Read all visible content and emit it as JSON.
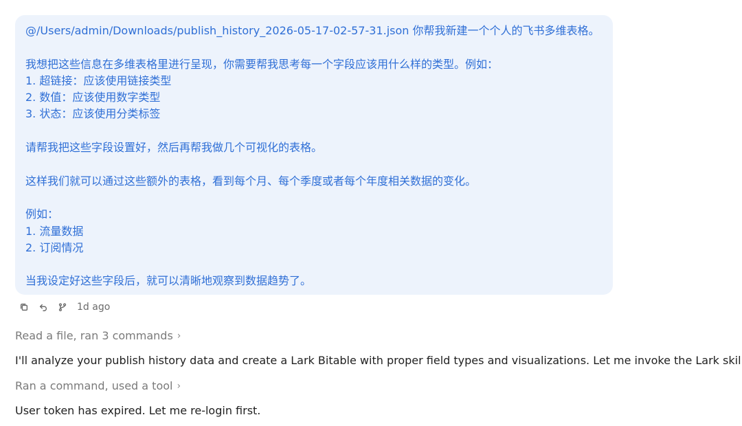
{
  "user_message": {
    "lines": [
      "@/Users/admin/Downloads/publish_history_2026-05-17-02-57-31.json 你帮我新建一个个人的飞书多维表格。",
      "",
      "我想把这些信息在多维表格里进行呈现，你需要帮我思考每一个字段应该用什么样的类型。例如：",
      "1. 超链接：应该使用链接类型",
      "2. 数值：应该使用数字类型",
      "3. 状态：应该使用分类标签",
      "",
      "请帮我把这些字段设置好，然后再帮我做几个可视化的表格。",
      "",
      "这样我们就可以通过这些额外的表格，看到每个月、每个季度或者每个年度相关数据的变化。",
      "",
      "例如：",
      "1. 流量数据",
      "2. 订阅情况",
      "",
      "当我设定好这些字段后，就可以清晰地观察到数据趋势了。"
    ],
    "timestamp": "1d ago",
    "actions": [
      {
        "name": "copy-icon"
      },
      {
        "name": "undo-icon"
      },
      {
        "name": "branch-icon"
      }
    ]
  },
  "activity_1": "Read a file, ran 3 commands",
  "assistant_1": "I'll analyze your publish history data and create a Lark Bitable with proper field types and visualizations. Let me invoke the Lark skill.",
  "activity_2": "Ran a command, used a tool",
  "assistant_2": "User token has expired. Let me re-login first."
}
